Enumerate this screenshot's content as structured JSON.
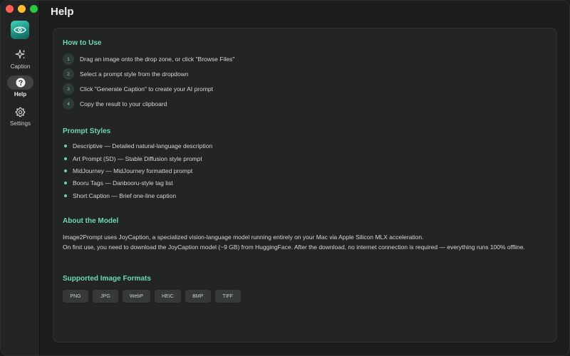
{
  "window": {
    "title": "Help"
  },
  "sidebar": {
    "items": [
      {
        "label": "Caption",
        "icon": "sparkles-icon"
      },
      {
        "label": "Help",
        "icon": "question-circle-icon"
      },
      {
        "label": "Settings",
        "icon": "gear-icon"
      }
    ],
    "active": "Help"
  },
  "help": {
    "how_to_use": {
      "title": "How to Use",
      "steps": [
        {
          "num": "1",
          "text": "Drag an image onto the drop zone, or click \"Browse Files\""
        },
        {
          "num": "2",
          "text": "Select a prompt style from the dropdown"
        },
        {
          "num": "3",
          "text": "Click \"Generate Caption\" to create your AI prompt"
        },
        {
          "num": "4",
          "text": "Copy the result to your clipboard"
        }
      ]
    },
    "prompt_styles": {
      "title": "Prompt Styles",
      "items": [
        "Descriptive — Detailed natural-language description",
        "Art Prompt (SD) — Stable Diffusion style prompt",
        "MidJourney — MidJourney formatted prompt",
        "Booru Tags — Danbooru-style tag list",
        "Short Caption — Brief one-line caption"
      ]
    },
    "about": {
      "title": "About the Model",
      "para1": "Image2Prompt uses JoyCaption, a specialized vision-language model running entirely on your Mac via Apple Silicon MLX acceleration.",
      "para2": "On first use, you need to download the JoyCaption model (~9 GB) from HuggingFace. After the download, no internet connection is required — everything runs 100% offline."
    },
    "formats": {
      "title": "Supported Image Formats",
      "items": [
        "PNG",
        "JPG",
        "WebP",
        "HEIC",
        "BMP",
        "TIFF"
      ]
    }
  },
  "colors": {
    "accent": "#6fd6b2",
    "background": "#1c1e1e",
    "card": "#222524",
    "sidebar": "#232525"
  }
}
